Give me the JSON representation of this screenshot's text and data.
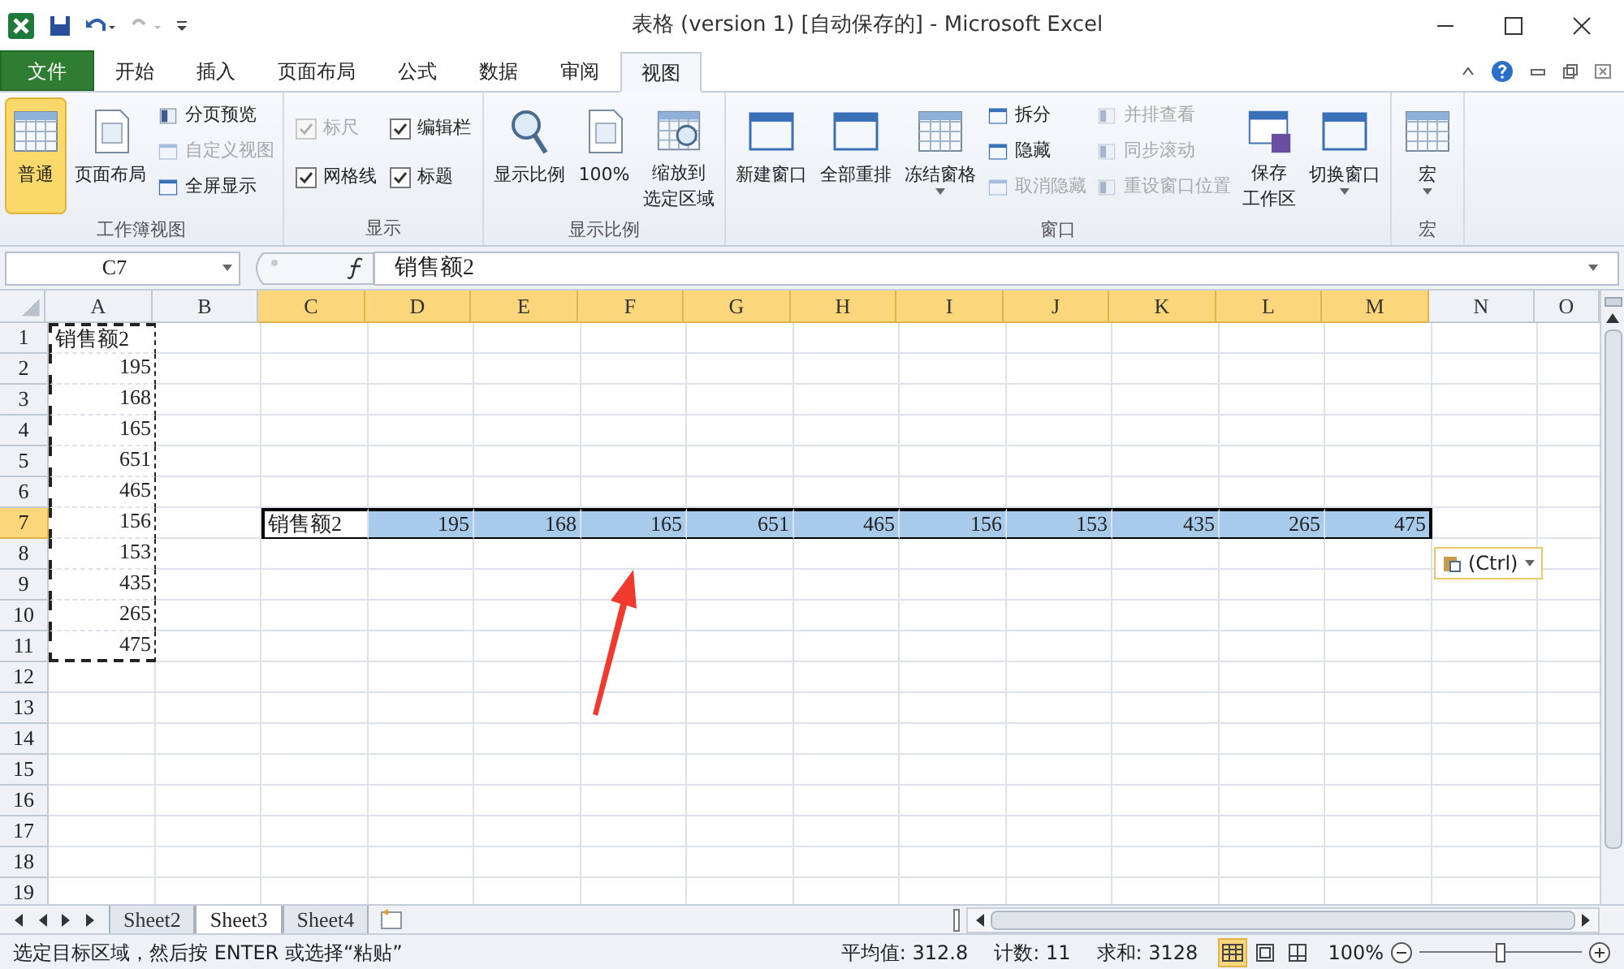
{
  "window": {
    "title": "表格 (version 1) [自动保存的] - Microsoft Excel"
  },
  "menu_tabs": [
    {
      "label": "文件",
      "kind": "file",
      "selected": false
    },
    {
      "label": "开始",
      "kind": "tab",
      "selected": false
    },
    {
      "label": "插入",
      "kind": "tab",
      "selected": false
    },
    {
      "label": "页面布局",
      "kind": "tab",
      "selected": false
    },
    {
      "label": "公式",
      "kind": "tab",
      "selected": false
    },
    {
      "label": "数据",
      "kind": "tab",
      "selected": false
    },
    {
      "label": "审阅",
      "kind": "tab",
      "selected": false
    },
    {
      "label": "视图",
      "kind": "tab",
      "selected": true
    }
  ],
  "ribbon_groups": [
    {
      "title": "工作簿视图",
      "items": [
        {
          "kind": "large",
          "lines": [
            "普通"
          ],
          "selected": true,
          "disabled": false
        },
        {
          "kind": "large",
          "lines": [
            "页面布局"
          ],
          "selected": false,
          "disabled": false
        },
        {
          "kind": "small",
          "label": "分页预览",
          "disabled": false
        },
        {
          "kind": "small",
          "label": "自定义视图",
          "disabled": true
        },
        {
          "kind": "small",
          "label": "全屏显示",
          "disabled": false
        }
      ]
    },
    {
      "title": "显示",
      "items": [
        {
          "kind": "check",
          "label": "标尺",
          "checked": true,
          "disabled": true
        },
        {
          "kind": "check",
          "label": "编辑栏",
          "checked": true,
          "disabled": false
        },
        {
          "kind": "check",
          "label": "网格线",
          "checked": true,
          "disabled": false
        },
        {
          "kind": "check",
          "label": "标题",
          "checked": true,
          "disabled": false
        }
      ]
    },
    {
      "title": "显示比例",
      "items": [
        {
          "kind": "large",
          "lines": [
            "显示比例"
          ],
          "selected": false,
          "disabled": false
        },
        {
          "kind": "large",
          "lines": [
            "100%"
          ],
          "selected": false,
          "disabled": false
        },
        {
          "kind": "large",
          "lines": [
            "缩放到",
            "选定区域"
          ],
          "selected": false,
          "disabled": false
        }
      ]
    },
    {
      "title": "窗口",
      "items": [
        {
          "kind": "large",
          "lines": [
            "新建窗口"
          ],
          "selected": false,
          "disabled": false
        },
        {
          "kind": "large",
          "lines": [
            "全部重排"
          ],
          "selected": false,
          "disabled": false
        },
        {
          "kind": "large",
          "lines": [
            "冻结窗格"
          ],
          "selected": false,
          "disabled": false,
          "dropdown": true
        },
        {
          "kind": "small",
          "label": "拆分",
          "disabled": false
        },
        {
          "kind": "small",
          "label": "隐藏",
          "disabled": false
        },
        {
          "kind": "small",
          "label": "取消隐藏",
          "disabled": true
        },
        {
          "kind": "small2",
          "label": "并排查看",
          "disabled": true
        },
        {
          "kind": "small2",
          "label": "同步滚动",
          "disabled": true
        },
        {
          "kind": "small2",
          "label": "重设窗口位置",
          "disabled": true
        },
        {
          "kind": "large",
          "lines": [
            "保存",
            "工作区"
          ],
          "selected": false,
          "disabled": false
        },
        {
          "kind": "large",
          "lines": [
            "切换窗口"
          ],
          "selected": false,
          "disabled": false,
          "dropdown": true
        }
      ]
    },
    {
      "title": "宏",
      "items": [
        {
          "kind": "large",
          "lines": [
            "宏"
          ],
          "selected": false,
          "disabled": false,
          "dropdown": true
        }
      ]
    }
  ],
  "formula_bar": {
    "name_box": "C7",
    "content": "销售额2"
  },
  "columns": [
    {
      "label": "A",
      "selected": false
    },
    {
      "label": "B",
      "selected": false
    },
    {
      "label": "C",
      "selected": true
    },
    {
      "label": "D",
      "selected": true
    },
    {
      "label": "E",
      "selected": true
    },
    {
      "label": "F",
      "selected": true
    },
    {
      "label": "G",
      "selected": true
    },
    {
      "label": "H",
      "selected": true
    },
    {
      "label": "I",
      "selected": true
    },
    {
      "label": "J",
      "selected": true
    },
    {
      "label": "K",
      "selected": true
    },
    {
      "label": "L",
      "selected": true
    },
    {
      "label": "M",
      "selected": true
    },
    {
      "label": "N",
      "selected": false
    },
    {
      "label": "O",
      "selected": false
    }
  ],
  "rows": [
    {
      "number": "1",
      "selected": false,
      "copied": true,
      "cells": {
        "A": {
          "text": "销售额2",
          "kind": "text"
        }
      }
    },
    {
      "number": "2",
      "selected": false,
      "copied": true,
      "cells": {
        "A": {
          "text": "195",
          "kind": "number"
        }
      }
    },
    {
      "number": "3",
      "selected": false,
      "copied": true,
      "cells": {
        "A": {
          "text": "168",
          "kind": "number"
        }
      }
    },
    {
      "number": "4",
      "selected": false,
      "copied": true,
      "cells": {
        "A": {
          "text": "165",
          "kind": "number"
        }
      }
    },
    {
      "number": "5",
      "selected": false,
      "copied": true,
      "cells": {
        "A": {
          "text": "651",
          "kind": "number"
        }
      }
    },
    {
      "number": "6",
      "selected": false,
      "copied": true,
      "cells": {
        "A": {
          "text": "465",
          "kind": "number"
        }
      }
    },
    {
      "number": "7",
      "selected": true,
      "copied": true,
      "cells": {
        "A": {
          "text": "156",
          "kind": "number"
        },
        "C": {
          "text": "销售额2",
          "kind": "text",
          "active": true
        },
        "D": {
          "text": "195",
          "kind": "number"
        },
        "E": {
          "text": "168",
          "kind": "number"
        },
        "F": {
          "text": "165",
          "kind": "number"
        },
        "G": {
          "text": "651",
          "kind": "number"
        },
        "H": {
          "text": "465",
          "kind": "number"
        },
        "I": {
          "text": "156",
          "kind": "number"
        },
        "J": {
          "text": "153",
          "kind": "number"
        },
        "K": {
          "text": "435",
          "kind": "number"
        },
        "L": {
          "text": "265",
          "kind": "number"
        },
        "M": {
          "text": "475",
          "kind": "number"
        }
      }
    },
    {
      "number": "8",
      "selected": false,
      "copied": true,
      "cells": {
        "A": {
          "text": "153",
          "kind": "number"
        }
      }
    },
    {
      "number": "9",
      "selected": false,
      "copied": true,
      "cells": {
        "A": {
          "text": "435",
          "kind": "number"
        }
      }
    },
    {
      "number": "10",
      "selected": false,
      "copied": true,
      "cells": {
        "A": {
          "text": "265",
          "kind": "number"
        }
      }
    },
    {
      "number": "11",
      "selected": false,
      "copied": true,
      "cells": {
        "A": {
          "text": "475",
          "kind": "number"
        }
      }
    },
    {
      "number": "12",
      "selected": false,
      "copied": false
    },
    {
      "number": "13",
      "selected": false,
      "copied": false
    },
    {
      "number": "14",
      "selected": false,
      "copied": false
    },
    {
      "number": "15",
      "selected": false,
      "copied": false
    },
    {
      "number": "16",
      "selected": false,
      "copied": false
    },
    {
      "number": "17",
      "selected": false,
      "copied": false
    },
    {
      "number": "18",
      "selected": false,
      "copied": false
    },
    {
      "number": "19",
      "selected": false,
      "copied": false
    }
  ],
  "paste_options": {
    "label": "(Ctrl)"
  },
  "sheet_tabs": [
    {
      "label": "Sheet2",
      "selected": false
    },
    {
      "label": "Sheet3",
      "selected": true
    },
    {
      "label": "Sheet4",
      "selected": false
    }
  ],
  "status_bar": {
    "message": "选定目标区域，然后按 ENTER 或选择“粘贴”",
    "average": "平均值: 312.8",
    "count": "计数: 11",
    "sum": "求和: 3128",
    "views": [
      {
        "kind": "normal",
        "selected": true
      },
      {
        "kind": "layout",
        "selected": false
      },
      {
        "kind": "pagebreak",
        "selected": false
      }
    ],
    "zoom": "100%",
    "zoom_slider": {
      "level": 0.5
    }
  }
}
